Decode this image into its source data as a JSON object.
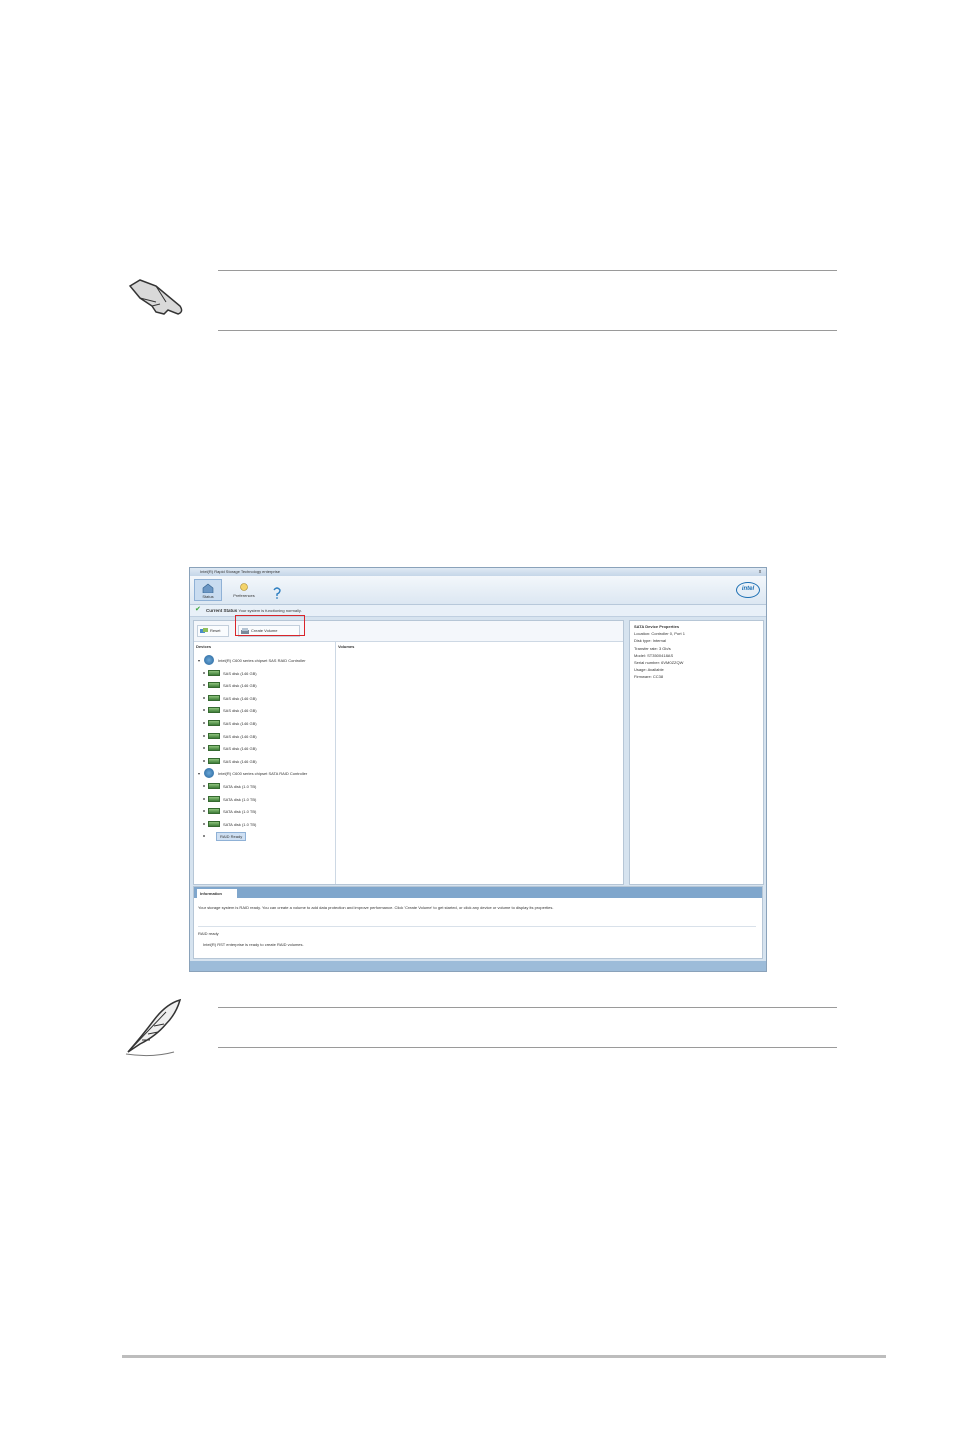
{
  "notes": {
    "important_icon": "pointing-hand-icon",
    "note_icon": "feather-quill-icon"
  },
  "app": {
    "title": "Intel(R) Rapid Storage Technology enterprise",
    "close_glyph": "x",
    "toolbar": [
      {
        "label": "Status",
        "icon": "house-icon",
        "active": true
      },
      {
        "label": "Preferences",
        "icon": "preferences-icon",
        "active": false
      }
    ],
    "help_icon": "help-icon",
    "logo_text": "intel",
    "status": {
      "heading": "Current Status",
      "message": "Your system is functioning normally."
    },
    "actions": [
      {
        "label": "Reset",
        "icon": "reset-icon"
      },
      {
        "label": "Create Volume",
        "icon": "create-volume-icon"
      }
    ],
    "devices_header": "Devices",
    "volumes_header": "Volumes",
    "tree": [
      {
        "type": "controller",
        "label": "Intel(R) C600 series chipset SAS RAID Controller"
      },
      {
        "type": "drive",
        "label": "SAS disk (146 GB)"
      },
      {
        "type": "drive",
        "label": "SAS disk (146 GB)"
      },
      {
        "type": "drive",
        "label": "SAS disk (146 GB)"
      },
      {
        "type": "drive",
        "label": "SAS disk (146 GB)"
      },
      {
        "type": "drive",
        "label": "SAS disk (146 GB)"
      },
      {
        "type": "drive",
        "label": "SAS disk (146 GB)"
      },
      {
        "type": "drive",
        "label": "SAS disk (146 GB)"
      },
      {
        "type": "drive",
        "label": "SAS disk (146 GB)"
      },
      {
        "type": "controller",
        "label": "Intel(R) C600 series chipset SATA RAID Controller"
      },
      {
        "type": "drive",
        "label": "SATA disk (1.0 TB)"
      },
      {
        "type": "drive",
        "label": "SATA disk (1.0 TB)"
      },
      {
        "type": "drive",
        "label": "SATA disk (1.0 TB)"
      },
      {
        "type": "drive",
        "label": "SATA disk (1.0 TB)"
      },
      {
        "type": "selected",
        "label": "RAID Ready"
      }
    ],
    "properties": {
      "title": "SATA Device Properties",
      "lines": [
        "Location: Controller 0, Port 1",
        "Disk type: Internal",
        "Transfer rate: 3 Gb/s",
        "Model: ST3500418AS",
        "Serial number: 6VM0ZZQW",
        "Usage: Available",
        "Firmware: CC38"
      ]
    },
    "info": {
      "tab": "Information",
      "text": "Your storage system is RAID ready. You can create a volume to add data protection and improve performance. Click 'Create Volume' to get started, or click any device or volume to display its properties.",
      "sub_heading": "RAID ready",
      "sub_text": "Intel(R) RST enterprise is ready to create RAID volumes."
    }
  }
}
